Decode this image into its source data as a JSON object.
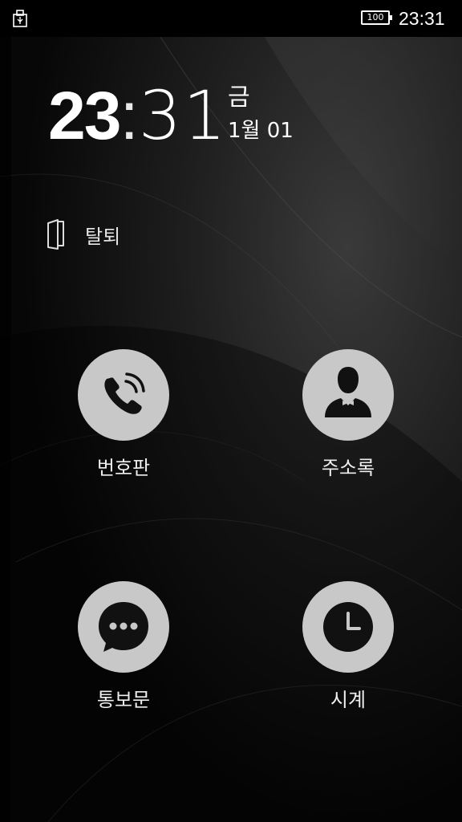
{
  "status_bar": {
    "battery_level": "100",
    "time": "23:31",
    "usb_icon": "usb-storage-icon",
    "battery_icon": "battery-icon"
  },
  "lock_clock": {
    "hour": "23",
    "colon": ":",
    "minute": "31",
    "day_of_week": "금",
    "date": "1월 01"
  },
  "exit": {
    "label": "탈퇴",
    "icon": "door-exit-icon"
  },
  "apps": [
    {
      "label": "번호판",
      "icon": "phone-icon"
    },
    {
      "label": "주소록",
      "icon": "contact-person-icon"
    },
    {
      "label": "통보문",
      "icon": "message-bubble-icon"
    },
    {
      "label": "시계",
      "icon": "clock-icon"
    }
  ],
  "colors": {
    "background": "#0a0a0a",
    "circle": "#c8c8c8",
    "icon_dark": "#111111",
    "text": "#ffffff"
  }
}
